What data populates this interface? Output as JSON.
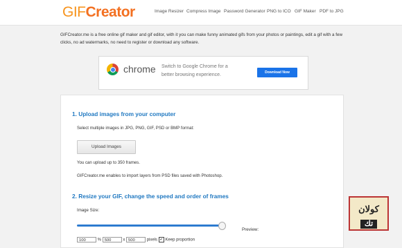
{
  "header": {
    "logo_gif": "GIF",
    "logo_creator": "Creator",
    "nav": [
      "Image Resizer",
      "Compress Image",
      "Password Generator",
      "PNG to ICO",
      "GIF Maker",
      "PDF to JPG"
    ]
  },
  "intro": "GIFCreator.me is a free online gif maker and gif editor, with it you can make funny animated gifs from your photos or paintings, edit a gif with a few clicks, no ad watermarks, no need to register or download any software.",
  "ad": {
    "brand": "chrome",
    "message": "Switch to Google Chrome for a better browsing experience.",
    "button": "Download Now"
  },
  "section1": {
    "heading": "1. Upload images from your computer",
    "formats": "Select multiple images in JPG, PNG, GIF, PSD or BMP format:",
    "upload_button": "Upload Images",
    "limit": "You can upload up to 350 frames.",
    "psd_note": "GIFCreator.me enables to import layers from PSD files saved with Photoshop."
  },
  "section2": {
    "heading": "2. Resize your GIF, change the speed and order of frames",
    "image_size_label": "Image Size:",
    "size_slider_percent": 100,
    "preview_label": "Preview:",
    "percent_value": "100",
    "percent_unit": "%",
    "width_value": "500",
    "x_sep": "x",
    "height_value": "500",
    "pixels_label": "pixels",
    "keep_proportion_label": "Keep proportion",
    "keep_proportion_checked": "✔"
  },
  "watermark": {
    "line1": "كولان",
    "line2": "تك"
  }
}
